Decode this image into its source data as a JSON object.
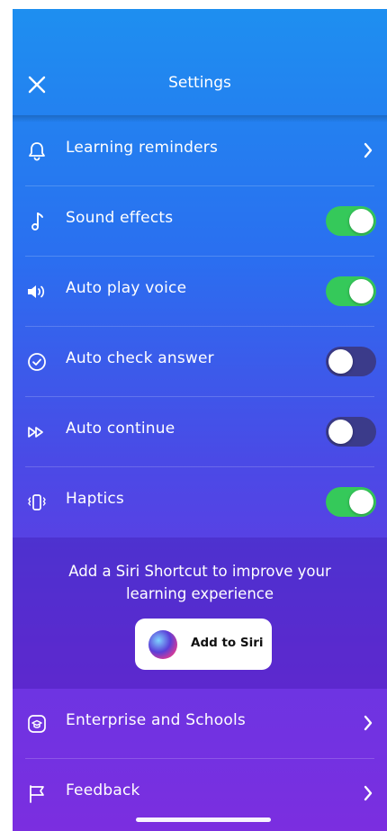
{
  "header": {
    "title": "Settings",
    "close_icon": "close-icon"
  },
  "rows": [
    {
      "label": "Learning reminders",
      "icon": "bell-icon",
      "control": "chevron"
    },
    {
      "label": "Sound effects",
      "icon": "music-note-icon",
      "control": "toggle",
      "state": "on"
    },
    {
      "label": "Auto play voice",
      "icon": "speaker-icon",
      "control": "toggle",
      "state": "on"
    },
    {
      "label": "Auto check answer",
      "icon": "check-circle-icon",
      "control": "toggle",
      "state": "off"
    },
    {
      "label": "Auto continue",
      "icon": "fast-forward-icon",
      "control": "toggle",
      "state": "off"
    },
    {
      "label": "Haptics",
      "icon": "vibrate-icon",
      "control": "toggle",
      "state": "on"
    }
  ],
  "siri": {
    "message": "Add a Siri Shortcut to improve your learning experience",
    "button_label": "Add to Siri"
  },
  "bottom_rows": [
    {
      "label": "Enterprise and Schools",
      "icon": "school-icon",
      "control": "chevron"
    },
    {
      "label": "Feedback",
      "icon": "flag-icon",
      "control": "chevron"
    }
  ],
  "colors": {
    "toggle_on": "#35c95a",
    "toggle_off": "#3b3b8a",
    "accent_top": "#1e8ff0",
    "accent_bottom": "#7b2ee0"
  }
}
